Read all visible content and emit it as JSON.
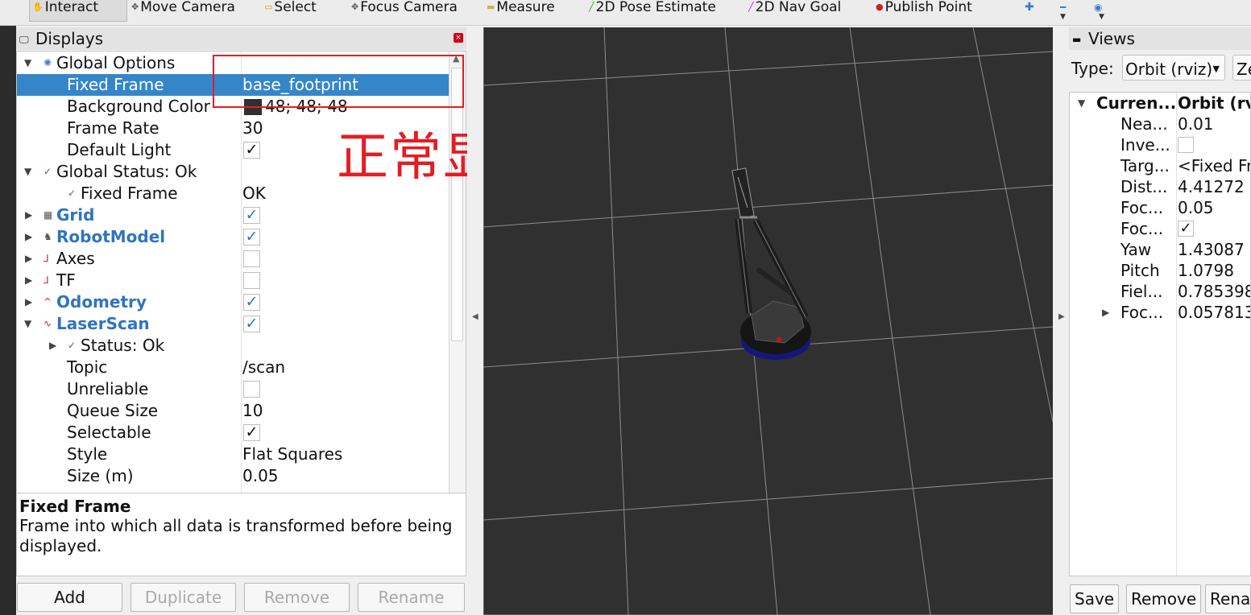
{
  "toolbar": {
    "tools": [
      {
        "label": "Interact",
        "icon": "hand-icon",
        "glyph": "✋",
        "color": "#333333"
      },
      {
        "label": "Move Camera",
        "icon": "move-camera-icon",
        "glyph": "✥",
        "color": "#555555"
      },
      {
        "label": "Select",
        "icon": "select-icon",
        "glyph": "▭",
        "color": "#d4a400"
      },
      {
        "label": "Focus Camera",
        "icon": "focus-camera-icon",
        "glyph": "✥",
        "color": "#555555"
      },
      {
        "label": "Measure",
        "icon": "measure-icon",
        "glyph": "▬",
        "color": "#c9b458"
      },
      {
        "label": "2D Pose Estimate",
        "icon": "pose-estimate-icon",
        "glyph": "╱",
        "color": "#22aa22"
      },
      {
        "label": "2D Nav Goal",
        "icon": "nav-goal-icon",
        "glyph": "╱",
        "color": "#cc22cc"
      },
      {
        "label": "Publish Point",
        "icon": "publish-point-icon",
        "glyph": "📍",
        "color": "#d02020"
      }
    ]
  },
  "displays": {
    "title": "Displays",
    "rows": [
      {
        "label": "Global Options"
      },
      {
        "label": "Fixed Frame",
        "value": "base_footprint"
      },
      {
        "label": "Background Color",
        "value": "48; 48; 48"
      },
      {
        "label": "Frame Rate",
        "value": "30"
      },
      {
        "label": "Default Light",
        "checked": true
      },
      {
        "label": "Global Status: Ok"
      },
      {
        "label": "Fixed Frame",
        "value": "OK"
      },
      {
        "label": "Grid",
        "checked": true
      },
      {
        "label": "RobotModel",
        "checked": true
      },
      {
        "label": "Axes",
        "checked": false
      },
      {
        "label": "TF",
        "checked": false
      },
      {
        "label": "Odometry",
        "checked": true
      },
      {
        "label": "LaserScan",
        "checked": true
      },
      {
        "label": "Status: Ok"
      },
      {
        "label": "Topic",
        "value": "/scan"
      },
      {
        "label": "Unreliable",
        "checked": false
      },
      {
        "label": "Queue Size",
        "value": "10"
      },
      {
        "label": "Selectable",
        "checked": true
      },
      {
        "label": "Style",
        "value": "Flat Squares"
      },
      {
        "label": "Size (m)",
        "value": "0.05"
      }
    ],
    "description_title": "Fixed Frame",
    "description_body": "Frame into which all data is transformed before being displayed.",
    "buttons": {
      "add": "Add",
      "duplicate": "Duplicate",
      "remove": "Remove",
      "rename": "Rename"
    }
  },
  "annotation": {
    "text": "正常显示",
    "color": "#e41d24"
  },
  "views": {
    "title": "Views",
    "type_label": "Type:",
    "type_value": "Orbit (rviz)",
    "zero_button": "Zero",
    "rows": [
      {
        "key": "Curren...",
        "value": "Orbit (rviz)"
      },
      {
        "key": "Nea...",
        "value": "0.01"
      },
      {
        "key": "Inve...",
        "checked": false
      },
      {
        "key": "Targ...",
        "value": "<Fixed Frame>"
      },
      {
        "key": "Dist...",
        "value": "4.41272"
      },
      {
        "key": "Foc...",
        "value": "0.05"
      },
      {
        "key": "Foc...",
        "checked": true
      },
      {
        "key": "Yaw",
        "value": "1.43087"
      },
      {
        "key": "Pitch",
        "value": "1.0798"
      },
      {
        "key": "Fiel...",
        "value": "0.785398"
      },
      {
        "key": "Foc...",
        "value": "0.057813"
      }
    ],
    "buttons": {
      "save": "Save",
      "remove": "Remove",
      "rename": "Rename"
    }
  },
  "colors": {
    "selection": "#3586c8",
    "viewport_background": "#303030",
    "grid_line": "#9a9a9a",
    "display_name_blue": "#2f74c0",
    "robot_base_blue": "#1a1a8c"
  }
}
